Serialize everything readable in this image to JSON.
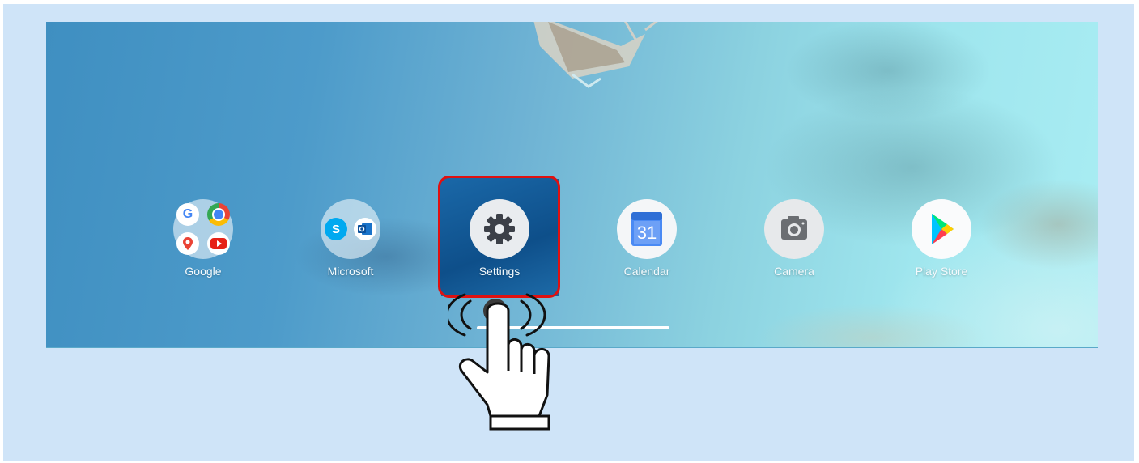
{
  "apps": [
    {
      "label": "Google"
    },
    {
      "label": "Microsoft"
    },
    {
      "label": "Settings"
    },
    {
      "label": "Calendar",
      "date": "31"
    },
    {
      "label": "Camera"
    },
    {
      "label": "Play Store"
    }
  ],
  "colors": {
    "highlight_border": "#e01010",
    "frame_bg": "#cfe4f8"
  },
  "icons": {
    "google_folder": [
      "google-g-icon",
      "chrome-icon",
      "maps-icon",
      "youtube-icon"
    ],
    "microsoft_folder": [
      "skype-icon",
      "outlook-icon"
    ],
    "settings": "gear-icon",
    "calendar": "calendar-icon",
    "camera": "camera-icon",
    "play_store": "play-store-icon",
    "tap_gesture": "tap-hand-icon"
  }
}
